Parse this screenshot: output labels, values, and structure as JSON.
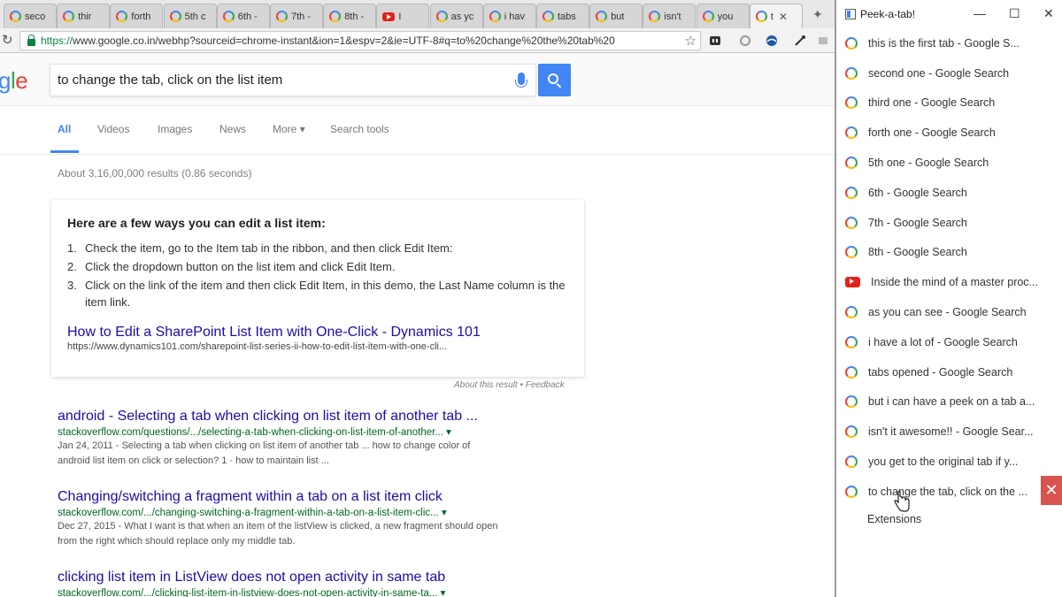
{
  "browser": {
    "tabs": [
      {
        "title": "seco",
        "favicon": "google"
      },
      {
        "title": "thir",
        "favicon": "google"
      },
      {
        "title": "forth",
        "favicon": "google"
      },
      {
        "title": "5th c",
        "favicon": "google"
      },
      {
        "title": "6th -",
        "favicon": "google"
      },
      {
        "title": "7th -",
        "favicon": "google"
      },
      {
        "title": "8th -",
        "favicon": "google"
      },
      {
        "title": "I",
        "favicon": "youtube"
      },
      {
        "title": "as yc",
        "favicon": "google"
      },
      {
        "title": "i hav",
        "favicon": "google"
      },
      {
        "title": "tabs",
        "favicon": "google"
      },
      {
        "title": "but",
        "favicon": "google"
      },
      {
        "title": "isn't",
        "favicon": "google"
      },
      {
        "title": "you",
        "favicon": "google"
      },
      {
        "title": "t",
        "favicon": "google",
        "active": true
      }
    ],
    "url_https": "https://",
    "url_rest": "www.google.co.in/webhp?sourceid=chrome-instant&ion=1&espv=2&ie=UTF-8#q=to%20change%20the%20tab%20"
  },
  "google": {
    "logo_letters": [
      "g",
      "l",
      "e"
    ],
    "query": "to change the tab, click on the list item",
    "nav": [
      "All",
      "Videos",
      "Images",
      "News",
      "More",
      "Search tools"
    ],
    "stats": "About 3,16,00,000 results (0.86 seconds)",
    "snippet": {
      "title": "Here are a few ways you can edit a list item:",
      "items": [
        "Check the item, go to the Item tab in the ribbon, and then click Edit Item:",
        "Click the dropdown button on the list item and click Edit Item.",
        "Click on the link of the item and then click Edit Item, in this demo, the Last Name column is the item link."
      ],
      "link": "How to Edit a SharePoint List Item with One-Click - Dynamics 101",
      "url": "https://www.dynamics101.com/sharepoint-list-series-ii-how-to-edit-list-item-with-one-cli...",
      "feedback": "About this result • Feedback"
    },
    "results": [
      {
        "title": "android - Selecting a tab when clicking on list item of another tab ...",
        "url": "stackoverflow.com/questions/.../selecting-a-tab-when-clicking-on-list-item-of-another...",
        "desc1": "Jan 24, 2011 - Selecting a tab when clicking on list item of another tab ... how to change color of",
        "desc2": "android list item on click or selection? 1 · how to maintain list ..."
      },
      {
        "title": "Changing/switching a fragment within a tab on a list item click",
        "url": "stackoverflow.com/.../changing-switching-a-fragment-within-a-tab-on-a-list-item-clic...",
        "desc1": "Dec 27, 2015 - What I want is that when an item of the listView is clicked, a new fragment should open",
        "desc2": "from the right which should replace only my middle tab."
      },
      {
        "title": "clicking list item in ListView does not open activity in same tab",
        "url": "stackoverflow.com/.../clicking-list-item-in-listview-does-not-open-activity-in-same-ta...",
        "desc1": "",
        "desc2": ""
      }
    ]
  },
  "popup": {
    "title": "Peek-a-tab!",
    "items": [
      {
        "label": "this is the first tab - Google S...",
        "favicon": "google"
      },
      {
        "label": "second one - Google Search",
        "favicon": "google"
      },
      {
        "label": "third one - Google Search",
        "favicon": "google"
      },
      {
        "label": "forth one - Google Search",
        "favicon": "google"
      },
      {
        "label": "5th one - Google Search",
        "favicon": "google"
      },
      {
        "label": "6th - Google Search",
        "favicon": "google"
      },
      {
        "label": "7th - Google Search",
        "favicon": "google"
      },
      {
        "label": "8th - Google Search",
        "favicon": "google"
      },
      {
        "label": "Inside the mind of a master proc...",
        "favicon": "youtube"
      },
      {
        "label": "as you can see - Google Search",
        "favicon": "google"
      },
      {
        "label": "i have a lot of - Google Search",
        "favicon": "google"
      },
      {
        "label": "tabs opened - Google Search",
        "favicon": "google"
      },
      {
        "label": "but i can have a peek on a tab a...",
        "favicon": "google"
      },
      {
        "label": "isn't it awesome!! - Google Sear...",
        "favicon": "google"
      },
      {
        "label": "you get to the original tab if y...",
        "favicon": "google"
      },
      {
        "label": "to change the tab, click on the ...",
        "favicon": "google"
      }
    ],
    "extensions_label": "Extensions",
    "close_symbol": "✕"
  },
  "colors": {
    "google_blue": "#4285f4",
    "link_blue": "#1a0dab",
    "url_green": "#006621",
    "close_red": "#d9534f"
  }
}
